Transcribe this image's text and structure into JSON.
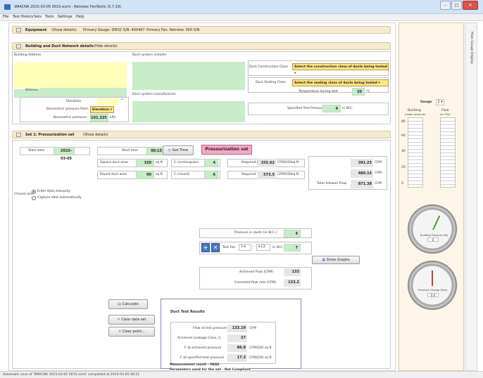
{
  "window": {
    "title": "SMACNA 2015-03-05 0015.evml - Retrotec FanTestic (5.7.19)",
    "min": "–",
    "max": "□",
    "close": "✕"
  },
  "menu": [
    "File",
    "Test History",
    "Sets",
    "Tools",
    "Settings",
    "Help"
  ],
  "equipment": {
    "heading": "Equipment",
    "show": "(Show details)",
    "gauge": "Primary Gauge: DM32 S/N: 400467",
    "fan": "Primary Fan: Retrotec 300 S/N"
  },
  "building": {
    "heading": "Building and Duct Network details",
    "hide": "(Hide details)",
    "address_label": "Building Address",
    "witness_label": "Witness",
    "elevation_label": "Elevation",
    "baro_from_label": "Barometric pressure from",
    "baro_from_value": "Elevation",
    "baro_label": "Barometric pressure",
    "baro_value": "101.325",
    "baro_unit": "kPa",
    "installer_label": "Duct system installer",
    "manufacturer_label": "Duct system manufacturer",
    "construction_label": "Duct Construction Class",
    "construction_value": "Select the construction class of ducts being tested",
    "sealing_label": "Duct Sealing Class",
    "sealing_value": "Select the sealing class of ducts being tested",
    "temp_label": "Temperature during test",
    "temp_value": "20",
    "temp_unit": "°C",
    "spec_label": "Specified Test Pressure",
    "spec_value": "4",
    "spec_unit": "in W.C."
  },
  "set": {
    "heading": "Set 1: Pressurization set",
    "show": "(Show details)",
    "start_date_label": "Start date",
    "start_date": "2015-03-05",
    "start_time_label": "Start time",
    "start_time": "00:15",
    "get_time": "Get Time",
    "mode": "Pressurization set",
    "square_label": "Square duct area",
    "square_value": "150",
    "square_unit": "sq ft",
    "round_label": "Round duct area",
    "round_value": "90",
    "round_unit": "sq ft",
    "cl_rect_label": "Cₗ (rectangular)",
    "cl_rect_value": "4",
    "cl_round_label": "Cₗ (round)",
    "cl_round_value": "6",
    "reqF_label": "Required F",
    "reqF_value": "255.62",
    "reqF_unit": "CFM/100sq ft",
    "reqT_label": "Required T",
    "reqT_value": "573.5",
    "reqT_unit": "CFM/100sq ft",
    "flow1": "391.25",
    "flow1_unit": "CFM",
    "flow2": "480.15",
    "flow2_unit": "CFM",
    "total_label": "Total Allowed Flow",
    "total_value": "871.38",
    "total_unit": "CFM",
    "choose_label": "Choose one:",
    "radio1": "Enter data manually",
    "radio2": "Capture data automatically",
    "pressure_label": "Pressure in ducts (in W.C.)",
    "pressure_value": "4",
    "fan_label": "Test Fan",
    "fan_select": "1",
    "ring_select": "C2",
    "inwc": "in W.C.",
    "fan_value": "7",
    "show_graphs": "Show Graphs",
    "achieved_label": "Achieved Flow (CFM)",
    "achieved_value": "133",
    "corrected_label": "Corrected flow rate (CFM)",
    "corrected_value": "133.2",
    "calculate": "Calculate",
    "clear_data": "Clear data set",
    "clear_point": "Clear point..."
  },
  "results": {
    "heading": "Duct Test Results",
    "flow_label": "Flow at test pressure",
    "flow_value": "133.19",
    "flow_unit": "CFM",
    "class_label": "Achieved Leakage Class, Cₗ",
    "class_value": "27",
    "pach_label": "F at achieved pressure",
    "pach_value": "86.8",
    "pach_unit": "CFM/100 sq ft",
    "pspec_label": "F at specified test pressure",
    "pspec_value": "17.3",
    "pspec_unit": "CFM/100 sq ft",
    "result": "Measurement result - PASS",
    "params": "Parameters used for the set - Not Compliant"
  },
  "gauge": {
    "label": "Gauge",
    "select": "1",
    "building": "Building",
    "building_sub": "(Lower pressure)",
    "flow": "Flow",
    "flow_sub": "(or Cf/h)",
    "ticks": [
      "80",
      "60",
      "40",
      "20",
      "0"
    ],
    "dial1_label": "Building Pressure (Pa)",
    "dial1_value": "0",
    "dial2_label": "Pressure Change (Pa/s)",
    "dial2_value": "0.0"
  },
  "sidetab": "Main Gauge Display",
  "status": "Automatic save of 'SMACNA 2015-03-05 0015.evml' completed at 2015-03-05 00:21"
}
